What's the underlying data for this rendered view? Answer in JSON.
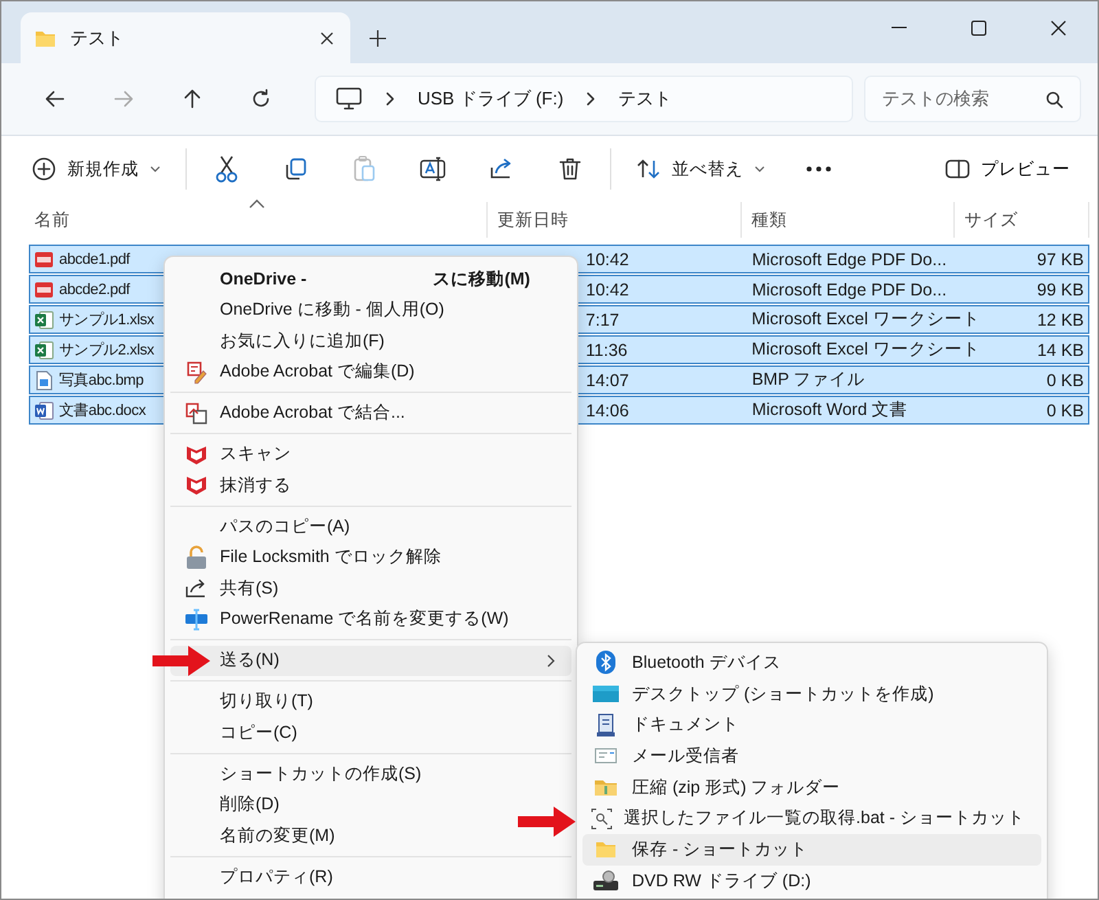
{
  "tabs": [
    {
      "label": "テスト",
      "selected": true
    }
  ],
  "nav": [
    {
      "kind": "back",
      "disabled": false
    },
    {
      "kind": "forward",
      "disabled": true
    },
    {
      "kind": "up",
      "disabled": false
    },
    {
      "kind": "refresh",
      "disabled": false
    }
  ],
  "address": {
    "segments": [
      "USB ドライブ (F:)",
      "テスト"
    ]
  },
  "search": {
    "placeholder": "テストの検索"
  },
  "toolbar": {
    "items": [
      {
        "kind": "new",
        "label": "新規作成",
        "disabled": false
      },
      {
        "kind": "cut",
        "disabled": false
      },
      {
        "kind": "copy",
        "disabled": false
      },
      {
        "kind": "paste",
        "disabled": true
      },
      {
        "kind": "rename",
        "disabled": false
      },
      {
        "kind": "share",
        "disabled": false
      },
      {
        "kind": "delete",
        "disabled": false
      },
      {
        "kind": "sort",
        "label": "並べ替え",
        "disabled": false
      },
      {
        "kind": "more",
        "disabled": false
      }
    ],
    "preview": {
      "label": "プレビュー"
    }
  },
  "columns": [
    {
      "label": "名前",
      "sorted": true
    },
    {
      "label": "更新日時",
      "sorted": false
    },
    {
      "label": "種類",
      "sorted": false
    },
    {
      "label": "サイズ",
      "sorted": false
    }
  ],
  "rows": [
    {
      "kind": "pdf",
      "name": "abcde1.pdf",
      "modified": "10:42",
      "type": "Microsoft Edge PDF Do...",
      "size": "97 KB",
      "selected": true
    },
    {
      "kind": "pdf",
      "name": "abcde2.pdf",
      "modified": "10:42",
      "type": "Microsoft Edge PDF Do...",
      "size": "99 KB",
      "selected": true
    },
    {
      "kind": "excel",
      "name": "サンプル1.xlsx",
      "modified": "7:17",
      "type": "Microsoft Excel ワークシート",
      "size": "12 KB",
      "selected": true
    },
    {
      "kind": "excel",
      "name": "サンプル2.xlsx",
      "modified": "11:36",
      "type": "Microsoft Excel ワークシート",
      "size": "14 KB",
      "selected": true
    },
    {
      "kind": "image",
      "name": "写真abc.bmp",
      "modified": "14:07",
      "type": "BMP ファイル",
      "size": "0 KB",
      "selected": true
    },
    {
      "kind": "word",
      "name": "文書abc.docx",
      "modified": "14:06",
      "type": "Microsoft Word 文書",
      "size": "0 KB",
      "selected": true
    }
  ],
  "context_menu": {
    "items": [
      {
        "kind": "split",
        "label": "OneDrive -",
        "label_2": "スに移動(M)",
        "highlighted": false
      },
      {
        "kind": "item",
        "label": "OneDrive に移動 - 個人用(O)",
        "highlighted": false
      },
      {
        "kind": "item",
        "label": "お気に入りに追加(F)",
        "highlighted": false
      },
      {
        "kind": "item",
        "label": "Adobe Acrobat で編集(D)",
        "highlighted": false
      },
      {
        "kind": "separator"
      },
      {
        "kind": "item",
        "label": "Adobe Acrobat で結合...",
        "highlighted": false
      },
      {
        "kind": "separator"
      },
      {
        "kind": "item",
        "label": "スキャン",
        "highlighted": false
      },
      {
        "kind": "item",
        "label": "抹消する",
        "highlighted": false
      },
      {
        "kind": "separator"
      },
      {
        "kind": "item",
        "label": "パスのコピー(A)",
        "highlighted": false
      },
      {
        "kind": "item",
        "label": "File Locksmith でロック解除",
        "highlighted": false
      },
      {
        "kind": "item",
        "label": "共有(S)",
        "highlighted": false
      },
      {
        "kind": "item",
        "label": "PowerRename で名前を変更する(W)",
        "highlighted": false
      },
      {
        "kind": "separator"
      },
      {
        "kind": "submenu",
        "label": "送る(N)",
        "highlighted": true
      },
      {
        "kind": "separator"
      },
      {
        "kind": "item",
        "label": "切り取り(T)",
        "highlighted": false
      },
      {
        "kind": "item",
        "label": "コピー(C)",
        "highlighted": false
      },
      {
        "kind": "separator"
      },
      {
        "kind": "item",
        "label": "ショートカットの作成(S)",
        "highlighted": false
      },
      {
        "kind": "item",
        "label": "削除(D)",
        "highlighted": false
      },
      {
        "kind": "item",
        "label": "名前の変更(M)",
        "highlighted": false
      },
      {
        "kind": "separator"
      },
      {
        "kind": "item",
        "label": "プロパティ(R)",
        "highlighted": false
      }
    ]
  },
  "send_to_menu": {
    "items": [
      {
        "label": "Bluetooth デバイス",
        "highlighted": false
      },
      {
        "label": "デスクトップ (ショートカットを作成)",
        "highlighted": false
      },
      {
        "label": "ドキュメント",
        "highlighted": false
      },
      {
        "label": "メール受信者",
        "highlighted": false
      },
      {
        "label": "圧縮 (zip 形式) フォルダー",
        "highlighted": false
      },
      {
        "label": "選択したファイル一覧の取得.bat - ショートカット",
        "highlighted": false
      },
      {
        "label": "保存 - ショートカット",
        "highlighted": true
      },
      {
        "label": "DVD RW ドライブ (D:)",
        "highlighted": false
      }
    ]
  }
}
